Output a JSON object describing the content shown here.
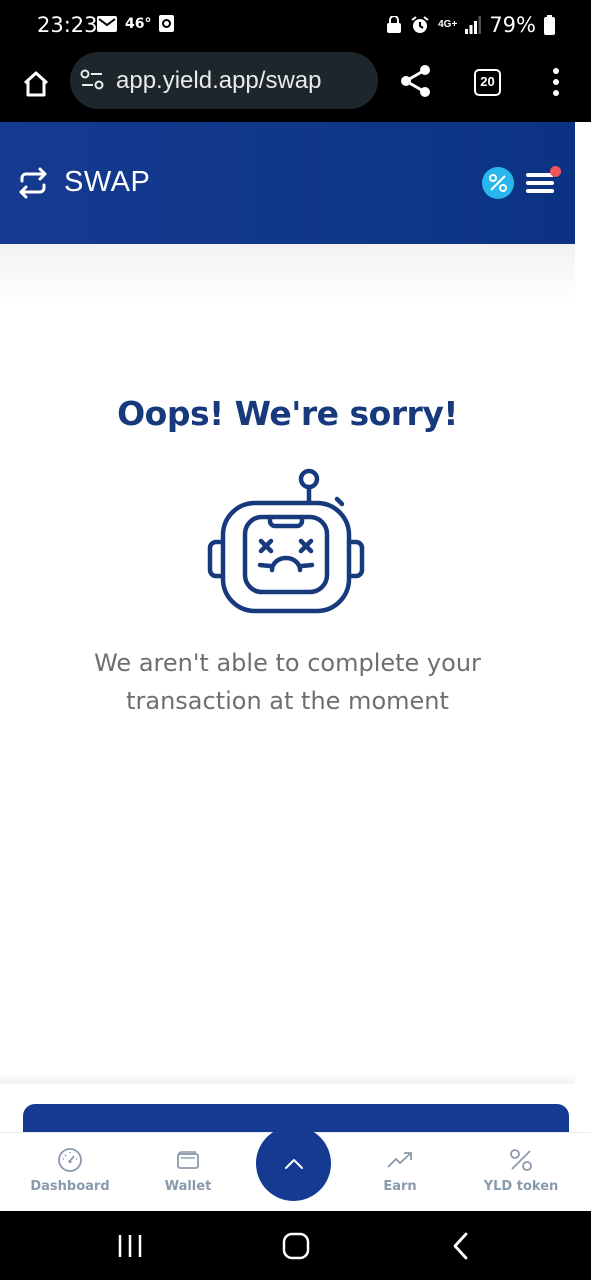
{
  "status_bar": {
    "time": "23:23",
    "temperature": "46°",
    "network_type": "4G+",
    "battery_percent": "79%"
  },
  "browser": {
    "url": "app.yield.app/swap",
    "tab_count": "20"
  },
  "header": {
    "title": "SWAP"
  },
  "error": {
    "title": "Oops! We're sorry!",
    "message_line1": "We aren't able to complete your",
    "message_line2": "transaction at the moment"
  },
  "bottom_nav": {
    "items": [
      {
        "label": "Dashboard",
        "icon": "dashboard-icon"
      },
      {
        "label": "Wallet",
        "icon": "wallet-icon"
      },
      {
        "label": "Earn",
        "icon": "earn-icon"
      },
      {
        "label": "YLD token",
        "icon": "percent-icon"
      }
    ]
  },
  "colors": {
    "brand_blue": "#153a91",
    "heading_blue": "#173a7c",
    "promo_cyan": "#28b6ef",
    "notification_red": "#f0545b"
  }
}
